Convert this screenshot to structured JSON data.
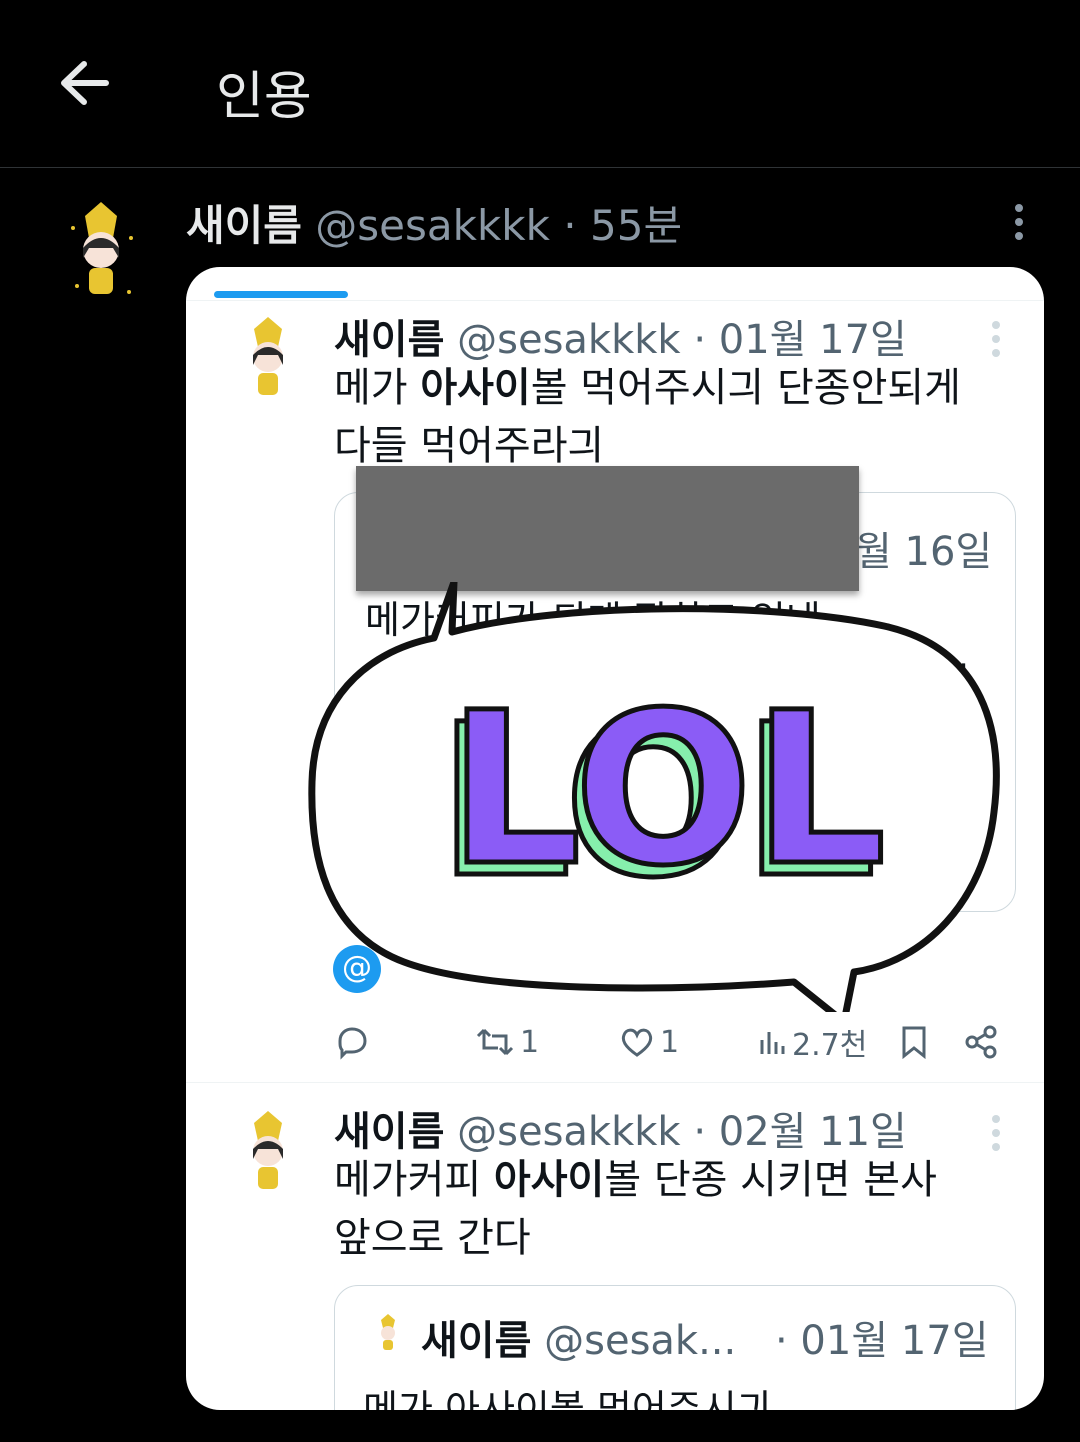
{
  "header": {
    "title": "인용",
    "back_icon": "arrow-left-icon"
  },
  "outer_tweet": {
    "name": "새이름",
    "handle": "@sesakkkk",
    "dot": "·",
    "time": "55분"
  },
  "tweets": [
    {
      "name": "새이름",
      "handle": "@sesakkkk",
      "dot": "·",
      "date": "01월 17일",
      "text_pre": "메가 ",
      "text_bold": "아사이",
      "text_post": "볼 먹어주시긔 단종안되게",
      "text_line2": "다들 먹어주라긔",
      "quote": {
        "date": "월 16일",
        "line1": "메가커피가 되게 잘하고 있네",
        "line2": "면"
      },
      "mention_badge": "@",
      "actions": {
        "retweets": "1",
        "likes": "1",
        "views": "2.7천"
      }
    },
    {
      "name": "새이름",
      "handle": "@sesakkkk",
      "dot": "·",
      "date": "02월 11일",
      "text_pre": "메가커피 ",
      "text_bold": "아사이",
      "text_post": "볼 단종 시키면 본사",
      "text_line2": "앞으로 간다",
      "quote": {
        "name": "새이름",
        "handle": "@sesak...",
        "date": "· 01월 17일",
        "line1": "메가 아사이볼 먹어주시긔"
      }
    }
  ],
  "sticker": {
    "text": "LOL",
    "fill": "#8b5cf6",
    "shadow": "#86efac"
  },
  "colors": {
    "accent": "#1d9bf0",
    "redaction": "#6b6b6b"
  }
}
